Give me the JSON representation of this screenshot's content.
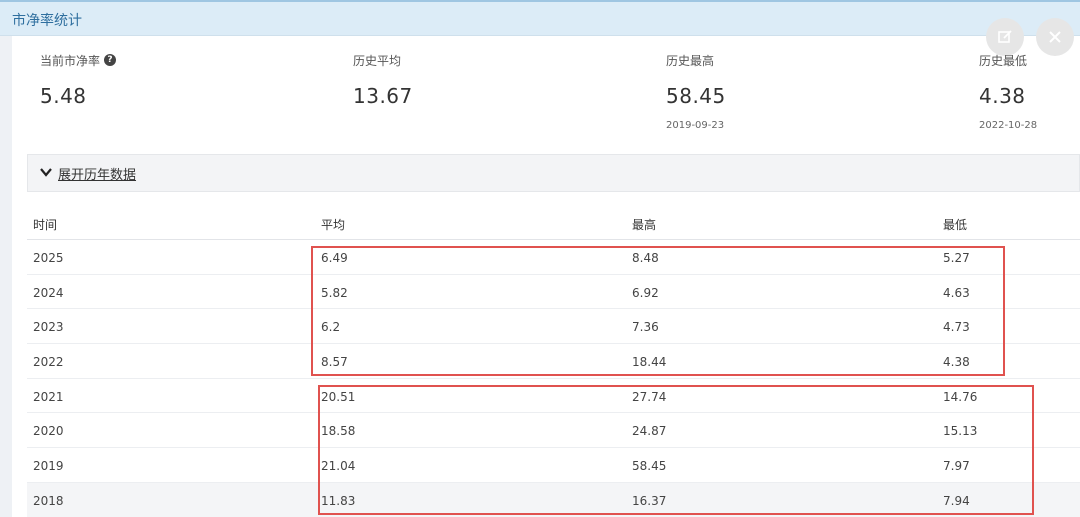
{
  "window": {
    "title": "市净率统计"
  },
  "summary": {
    "current": {
      "label": "当前市净率",
      "value": "5.48"
    },
    "average": {
      "label": "历史平均",
      "value": "13.67"
    },
    "highest": {
      "label": "历史最高",
      "value": "58.45",
      "date": "2019-09-23"
    },
    "lowest": {
      "label": "历史最低",
      "value": "4.38",
      "date": "2022-10-28"
    }
  },
  "icons": {
    "help": "question-circle-icon",
    "edit": "edit-icon",
    "close": "close-icon",
    "expand": "chevron-down-icon"
  },
  "expander": {
    "label": "展开历年数据"
  },
  "table": {
    "headers": [
      "时间",
      "平均",
      "最高",
      "最低"
    ],
    "rows": [
      [
        "2025",
        "6.49",
        "8.48",
        "5.27"
      ],
      [
        "2024",
        "5.82",
        "6.92",
        "4.63"
      ],
      [
        "2023",
        "6.2",
        "7.36",
        "4.73"
      ],
      [
        "2022",
        "8.57",
        "18.44",
        "4.38"
      ],
      [
        "2021",
        "20.51",
        "27.74",
        "14.76"
      ],
      [
        "2020",
        "18.58",
        "24.87",
        "15.13"
      ],
      [
        "2019",
        "21.04",
        "58.45",
        "7.97"
      ],
      [
        "2018",
        "11.83",
        "16.37",
        "7.94"
      ]
    ]
  },
  "colors": {
    "highlight": "#e0524f",
    "titlebar": "#dcecf7",
    "title_text": "#2f6f9f"
  }
}
